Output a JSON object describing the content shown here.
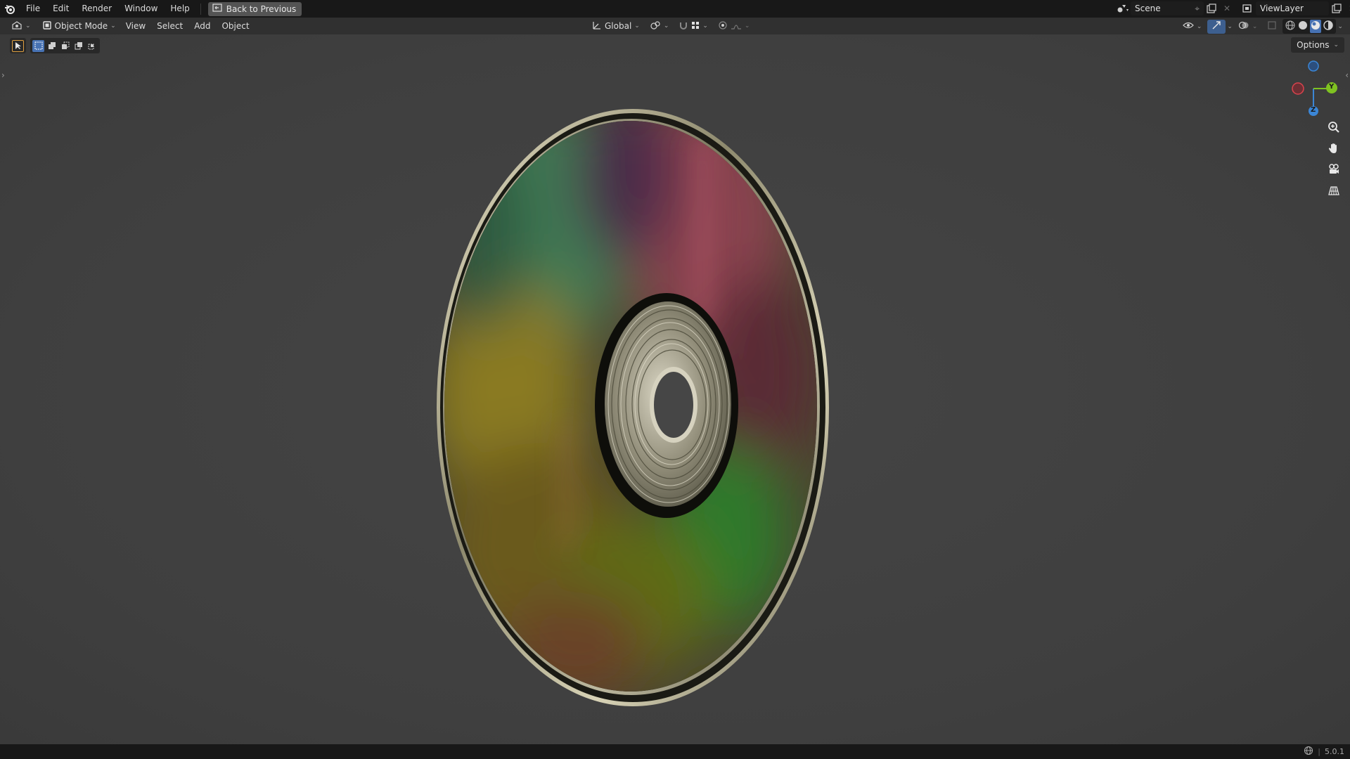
{
  "menus": [
    "File",
    "Edit",
    "Render",
    "Window",
    "Help"
  ],
  "back_button": "Back to Previous",
  "scene": {
    "name": "Scene"
  },
  "view_layer": {
    "name": "ViewLayer"
  },
  "header": {
    "mode": "Object Mode",
    "menus": [
      "View",
      "Select",
      "Add",
      "Object"
    ],
    "transform_orientation": "Global"
  },
  "viewport": {
    "options_label": "Options",
    "gizmo": {
      "y_label": "Y",
      "z_label": "Z"
    }
  },
  "status": {
    "version": "5.0.1"
  },
  "icons": {
    "logo": "blender-logo-icon",
    "zoom": "zoom-icon",
    "pan": "hand-pan-icon",
    "camera": "camera-view-icon",
    "grid": "ortho-grid-icon"
  },
  "colors": {
    "topbar": "#181818",
    "header": "#303030",
    "viewport_bg": "#404040",
    "axis_x": "#d9434d",
    "axis_y": "#7fc221",
    "axis_z": "#3b86d6"
  }
}
